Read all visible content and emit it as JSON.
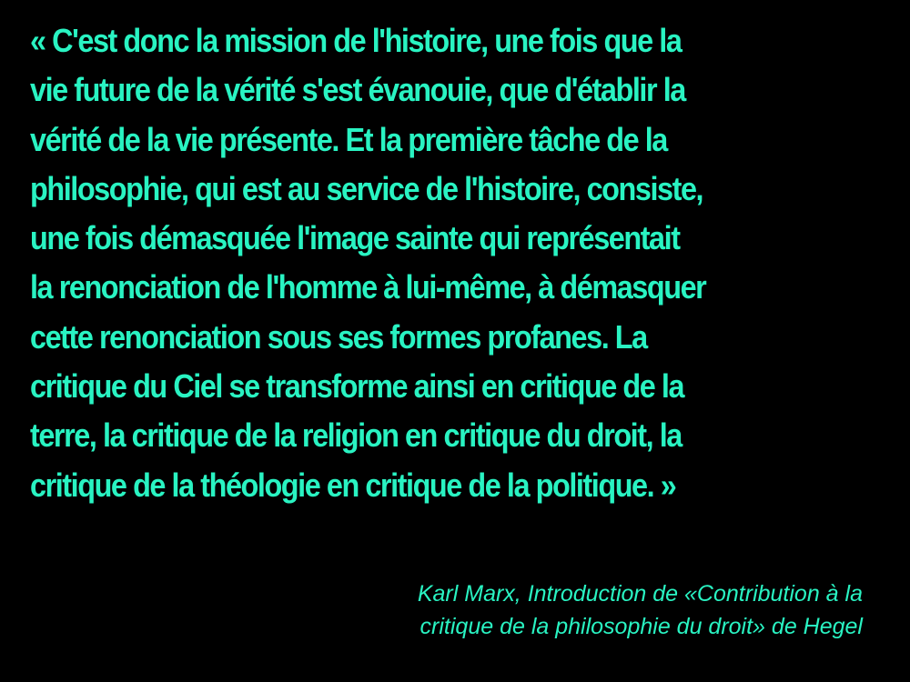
{
  "colors": {
    "background": "#000000",
    "text": "#29f3c2"
  },
  "quote": {
    "lines": [
      "« C'est donc la mission de l'histoire, une fois que la",
      "vie future de la vérité s'est évanouie, que d'établir la",
      "vérité de la vie présente. Et la première tâche de la",
      "philosophie, qui est au service de l'histoire, consiste,",
      "une fois démasquée l'image sainte qui représentait",
      "la renonciation de l'homme à lui-même, à démasquer",
      "cette renonciation sous ses formes profanes. La",
      "critique du Ciel se transforme ainsi en critique de la",
      "terre, la critique de la religion en critique du droit, la",
      "critique de la théologie en critique de la politique. »"
    ]
  },
  "attribution": {
    "lines": [
      "Karl Marx, Introduction de «Contribution à la",
      "critique de la philosophie du droit» de Hegel"
    ]
  }
}
